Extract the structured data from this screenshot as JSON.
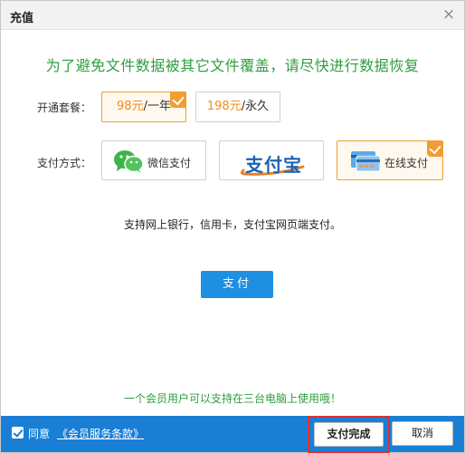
{
  "window": {
    "title": "充值",
    "close_glyph": "×"
  },
  "headline": "为了避免文件数据被其它文件覆盖，请尽快进行数据恢复",
  "plans": {
    "label": "开通套餐：",
    "items": [
      {
        "price": "98元",
        "period": "/一年",
        "selected": true
      },
      {
        "price": "198元",
        "period": "/永久",
        "selected": false
      }
    ]
  },
  "payment": {
    "label": "支付方式：",
    "items": [
      {
        "label": "微信支付",
        "icon": "wechat-icon",
        "selected": false
      },
      {
        "label": "支付宝",
        "icon": "alipay-logo",
        "selected": false
      },
      {
        "label": "在线支付",
        "icon": "bank-card-icon",
        "selected": true
      }
    ]
  },
  "info_text": "支持网上银行，信用卡，支付宝网页端支付。",
  "pay_button": "支付",
  "note": "一个会员用户可以支持在三台电脑上使用哦！",
  "footer": {
    "agree_label": "同意",
    "terms_link": "《会员服务条款》",
    "done_button": "支付完成",
    "cancel_button": "取消",
    "accent_color": "#1a7fd4",
    "highlight_color": "#e03030"
  },
  "colors": {
    "green": "#2e9e3e",
    "orange": "#f39c33",
    "blue": "#1e8fe1"
  }
}
